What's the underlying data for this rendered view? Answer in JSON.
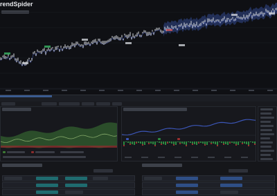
{
  "app": {
    "brand": "rendSpider"
  },
  "price_chart": {
    "series_color": "#d9dce2",
    "band_color": "#3a56a8",
    "ma_color": "#4a5fc4"
  },
  "equity_panel": {
    "green": "#3d7a35",
    "red": "#8a2d2d"
  },
  "performance_panel": {
    "blue": "#3c56b8",
    "green": "#2b8a40",
    "red": "#9a3030"
  }
}
